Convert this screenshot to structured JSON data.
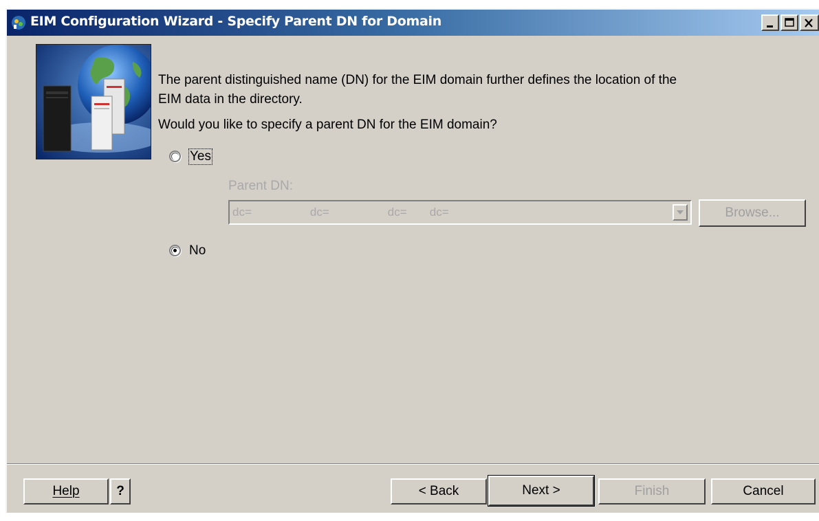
{
  "window": {
    "title": "EIM Configuration Wizard - Specify Parent DN for Domain"
  },
  "content": {
    "description_line1": "The parent distinguished name (DN) for the EIM domain further defines the location of the",
    "description_line2": "EIM data in the directory.",
    "question": "Would you like to specify a parent DN for the EIM domain?",
    "options": [
      {
        "label": "Yes",
        "selected": false
      },
      {
        "label": "No",
        "selected": true
      }
    ],
    "parent_dn_label": "Parent DN:",
    "parent_dn_value": "dc=                  dc=                  dc=       dc=",
    "browse_label": "Browse..."
  },
  "footer": {
    "help_label": "Help",
    "help_question": "?",
    "back_label": "< Back",
    "next_label": "Next >",
    "finish_label": "Finish",
    "cancel_label": "Cancel"
  },
  "colors": {
    "title_gradient_start": "#0a246a",
    "title_gradient_end": "#a6caf0",
    "dialog_face": "#d4d0c8",
    "disabled_text": "#a0a0a0"
  }
}
